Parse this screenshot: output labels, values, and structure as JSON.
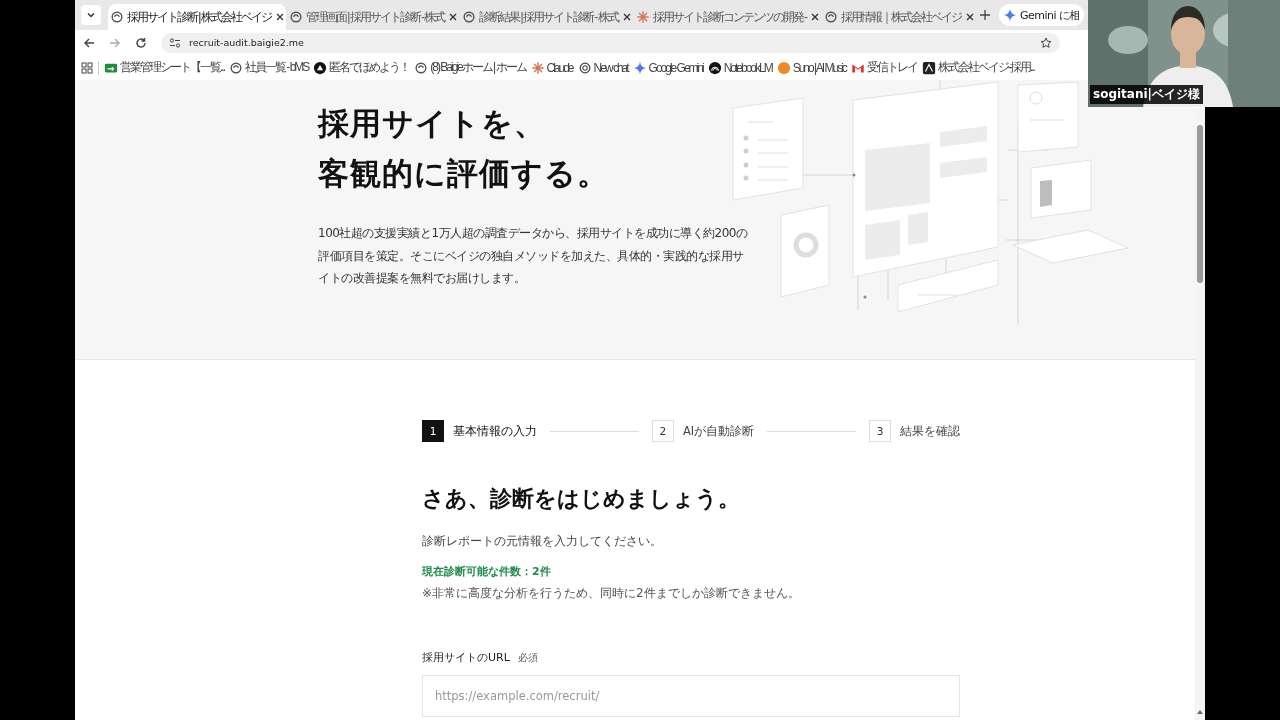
{
  "browser": {
    "tabs": [
      {
        "title": "採用サイト診断 | 株式会社ベイジ",
        "kind": "baigie",
        "selected": true
      },
      {
        "title": "管理画面 | 採用サイト診断 - 株式",
        "kind": "baigie",
        "selected": false
      },
      {
        "title": "診断結果 | 採用サイト診断 - 株式",
        "kind": "baigie",
        "selected": false
      },
      {
        "title": "採用サイト診断コンテンツの開発 -",
        "kind": "claude",
        "selected": false
      },
      {
        "title": "採用情報｜株式会社ベイジ",
        "kind": "baigie",
        "selected": false
      }
    ],
    "gemini_button": {
      "label": "Gemini に相"
    },
    "address": {
      "url": "recruit-audit.baigie2.me"
    },
    "bookmarks": [
      {
        "label": "営業管理シート【一覧...",
        "kind": "sheet"
      },
      {
        "label": "社員一覧 - bMS",
        "kind": "baigie"
      },
      {
        "label": "匿名でほめよう！",
        "kind": "triangle"
      },
      {
        "label": "(8) Baigieホーム | ホーム",
        "kind": "baigie"
      },
      {
        "label": "Claude",
        "kind": "claude"
      },
      {
        "label": "New chat",
        "kind": "chat"
      },
      {
        "label": "Google Gemini",
        "kind": "gemini"
      },
      {
        "label": "NotebookLM",
        "kind": "notebook"
      },
      {
        "label": "Suno | AI Music",
        "kind": "suno"
      },
      {
        "label": "受信トレイ",
        "kind": "mail"
      },
      {
        "label": "株式会社ベイジ-採用...",
        "kind": "company"
      }
    ]
  },
  "hero": {
    "title_lines": [
      "採用サイトを、",
      "客観的に評価する。"
    ],
    "description": "100社超の支援実績と1万人超の調査データから、採用サイトを成功に導く約200の評価項目を策定。そこにベイジの独自メソッドを加えた、具体的・実践的な採用サイトの改善提案を無料でお届けします。"
  },
  "steps": [
    {
      "number": "1",
      "label": "基本情報の入力",
      "selected": true
    },
    {
      "number": "2",
      "label": "AIが自動診断",
      "selected": false
    },
    {
      "number": "3",
      "label": "結果を確認",
      "selected": false
    }
  ],
  "form": {
    "heading": "さあ、診断をはじめましょう。",
    "intro": "診断レポートの元情報を入力してください。",
    "availability": "現在診断可能な件数：2件",
    "note": "※非常に高度な分析を行うため、同時に2件までしか診断できません。",
    "fields": [
      {
        "label": "採用サイトのURL",
        "required_badge": "必須",
        "placeholder": "https://example.com/recruit/"
      }
    ]
  },
  "video": {
    "name": "sogitani|ベイジ様"
  }
}
